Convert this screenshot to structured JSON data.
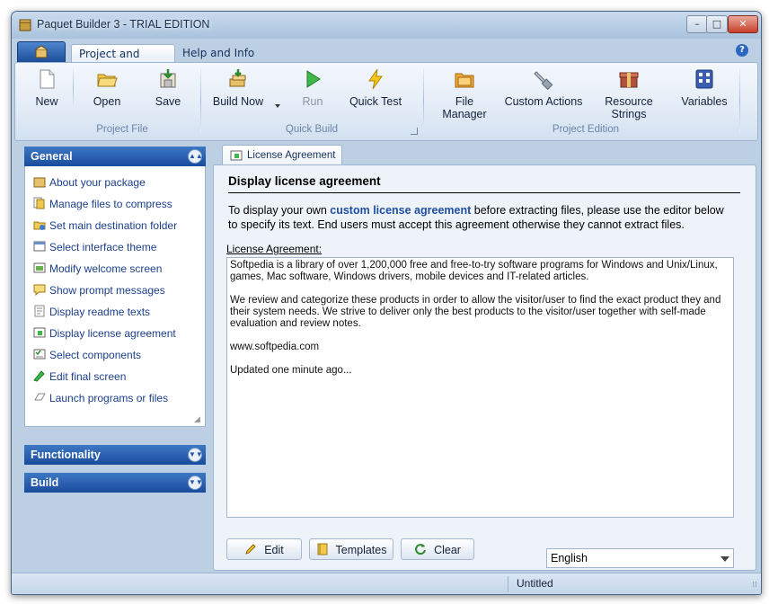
{
  "window": {
    "title": "Paquet Builder 3 - TRIAL EDITION",
    "controls": {
      "minimize": "–",
      "maximize": "□",
      "close": "✕"
    }
  },
  "ribbon": {
    "tabs": [
      {
        "label": "Project and Build",
        "active": true
      },
      {
        "label": "Help and Info",
        "active": false
      }
    ],
    "help_glyph": "?",
    "groups": [
      {
        "label": "Project File",
        "buttons": [
          {
            "label": "New",
            "icon": "new-document-icon",
            "enabled": true
          },
          {
            "label": "Open",
            "icon": "open-folder-icon",
            "enabled": true
          },
          {
            "label": "Save",
            "icon": "save-icon",
            "enabled": true
          }
        ]
      },
      {
        "label": "Quick Build",
        "buttons": [
          {
            "label": "Build Now",
            "icon": "build-icon",
            "enabled": true
          },
          {
            "label": "Run",
            "icon": "run-play-icon",
            "enabled": false
          },
          {
            "label": "Quick Test",
            "icon": "lightning-icon",
            "enabled": true
          }
        ]
      },
      {
        "label": "Project Edition",
        "buttons": [
          {
            "label": "File Manager",
            "icon": "file-manager-icon",
            "enabled": true
          },
          {
            "label": "Custom Actions",
            "icon": "custom-actions-icon",
            "enabled": true
          },
          {
            "label": "Resource Strings",
            "icon": "resource-strings-icon",
            "enabled": true
          },
          {
            "label": "Variables",
            "icon": "variables-icon",
            "enabled": true
          }
        ]
      }
    ]
  },
  "sidebar": {
    "sections": [
      {
        "label": "General",
        "expanded": true
      },
      {
        "label": "Functionality",
        "expanded": false
      },
      {
        "label": "Build",
        "expanded": false
      }
    ],
    "general_items": [
      {
        "label": "About your package",
        "icon": "package-icon"
      },
      {
        "label": "Manage files to compress",
        "icon": "files-icon"
      },
      {
        "label": "Set main destination folder",
        "icon": "destination-folder-icon"
      },
      {
        "label": "Select interface theme",
        "icon": "theme-icon"
      },
      {
        "label": "Modify welcome screen",
        "icon": "welcome-screen-icon"
      },
      {
        "label": "Show prompt messages",
        "icon": "prompt-message-icon"
      },
      {
        "label": "Display readme texts",
        "icon": "readme-icon"
      },
      {
        "label": "Display license agreement",
        "icon": "license-icon"
      },
      {
        "label": "Select components",
        "icon": "components-icon"
      },
      {
        "label": "Edit final screen",
        "icon": "final-screen-icon"
      },
      {
        "label": "Launch programs or files",
        "icon": "launch-icon"
      }
    ]
  },
  "content": {
    "tab_label": "License Agreement",
    "title": "Display license agreement",
    "instruction_pre": "To display your own ",
    "instruction_link": "custom license agreement",
    "instruction_post": " before extracting files, please use the editor below to specify its text. End users must accept this agreement otherwise they cannot extract files.",
    "editor_label": "License Agreement:",
    "editor_paragraphs": [
      "Softpedia is a library of over 1,200,000 free and free-to-try software programs for Windows and Unix/Linux, games, Mac software, Windows drivers, mobile devices and IT-related articles.",
      "We review and categorize these products in order to allow the visitor/user to find the exact product they and their system needs. We strive to deliver only the best products to the visitor/user together with self-made evaluation and review notes.",
      "www.softpedia.com",
      "Updated one minute ago..."
    ],
    "buttons": {
      "edit": "Edit",
      "templates": "Templates",
      "clear": "Clear"
    },
    "language": "English"
  },
  "statusbar": {
    "text": "Untitled"
  }
}
